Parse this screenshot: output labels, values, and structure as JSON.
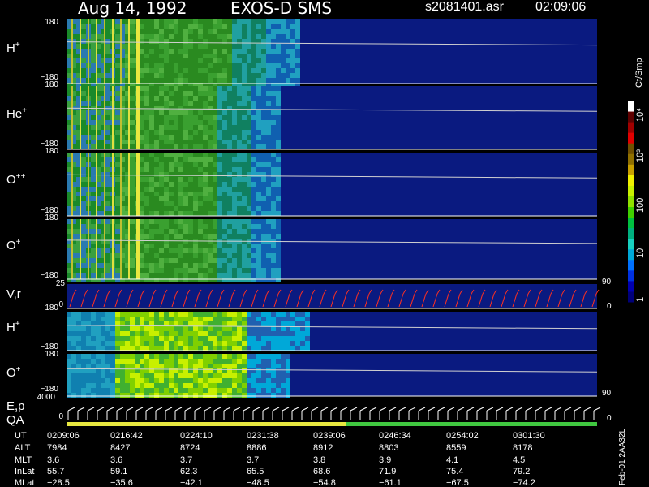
{
  "header": {
    "date": "Aug 14, 1992",
    "instrument": "EXOS-D SMS",
    "file": "s2081401.asr",
    "time": "02:09:06"
  },
  "panels": [
    {
      "species": "H",
      "charge": "+",
      "top_tick": "180",
      "bottom_tick": "−180"
    },
    {
      "species": "He",
      "charge": "+",
      "top_tick": "180",
      "bottom_tick": "−180"
    },
    {
      "species": "O",
      "charge": "++",
      "top_tick": "180",
      "bottom_tick": "−180"
    },
    {
      "species": "O",
      "charge": "+",
      "top_tick": "180",
      "bottom_tick": "−180"
    }
  ],
  "vr_panel": {
    "label": "V,r",
    "top_tick": "25",
    "mid_tick": "0",
    "right_top": "90",
    "right_bottom": "0"
  },
  "lower_panels": [
    {
      "species": "H",
      "charge": "+",
      "top_tick": "180",
      "bottom_tick": "−180"
    },
    {
      "species": "O",
      "charge": "+",
      "top_tick": "180",
      "bottom_tick": "−180",
      "right_tick": "90"
    }
  ],
  "ep_panel": {
    "label1": "E,p",
    "label2": "QA",
    "top_tick": "4000",
    "mid_tick": "0",
    "right_tick": "0"
  },
  "colorbar": {
    "title": "Ct/Smp",
    "ticks": [
      "1",
      "10",
      "100",
      "10³",
      "10⁴"
    ],
    "colors": [
      "#00007a",
      "#0000b0",
      "#0030e0",
      "#0070ff",
      "#00a8d8",
      "#18d0c0",
      "#00b080",
      "#00c040",
      "#40d000",
      "#90e000",
      "#c8f000",
      "#f0f000",
      "#c8a000",
      "#907000",
      "#705000",
      "#e00000",
      "#a00000",
      "#600000",
      "#ffffff"
    ]
  },
  "footer": {
    "labels": [
      "UT",
      "ALT",
      "MLT",
      "InLat",
      "MLat"
    ],
    "columns": [
      {
        "ut": "0209:06",
        "alt": "7984",
        "mlt": "3.6",
        "inlat": "55.7",
        "mlat": "−28.5"
      },
      {
        "ut": "0216:42",
        "alt": "8427",
        "mlt": "3.6",
        "inlat": "59.1",
        "mlat": "−35.6"
      },
      {
        "ut": "0224:10",
        "alt": "8724",
        "mlt": "3.7",
        "inlat": "62.3",
        "mlat": "−42.1"
      },
      {
        "ut": "0231:38",
        "alt": "8886",
        "mlt": "3.7",
        "inlat": "65.5",
        "mlat": "−48.5"
      },
      {
        "ut": "0239:06",
        "alt": "8912",
        "mlt": "3.8",
        "inlat": "68.6",
        "mlat": "−54.8"
      },
      {
        "ut": "0246:34",
        "alt": "8803",
        "mlt": "3.9",
        "inlat": "71.9",
        "mlat": "−61.1"
      },
      {
        "ut": "0254:02",
        "alt": "8559",
        "mlt": "4.1",
        "inlat": "75.4",
        "mlat": "−67.5"
      },
      {
        "ut": "0301:30",
        "alt": "8178",
        "mlt": "4.5",
        "inlat": "79.2",
        "mlat": "−74.2"
      }
    ]
  },
  "stamp": "Feb-01 2AA32L",
  "chart_data": {
    "type": "heatmap",
    "title": "Aug 14, 1992   EXOS-D SMS",
    "x_tick_labels": [
      "0209:06",
      "0216:42",
      "0224:10",
      "0231:38",
      "0239:06",
      "0246:34",
      "0254:02",
      "0301:30"
    ],
    "panels": [
      "H+",
      "He+",
      "O++",
      "O+",
      "V,r",
      "H+",
      "O+",
      "E,p / QA"
    ],
    "colorbar_label": "Ct/Smp",
    "colorbar_ticks": [
      "1",
      "10",
      "100",
      "10³",
      "10⁴"
    ],
    "y_range": [
      -180,
      180
    ]
  }
}
